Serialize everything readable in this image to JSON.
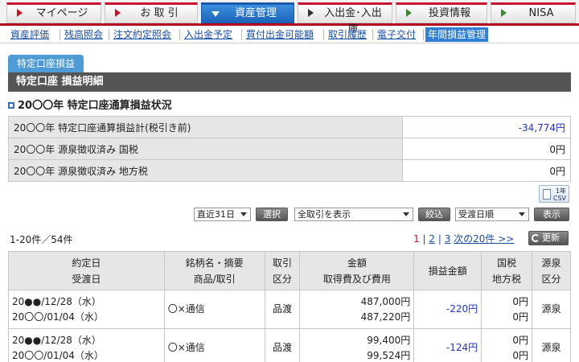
{
  "topnav": [
    {
      "label": "マイページ",
      "arrow": "red",
      "active": false
    },
    {
      "label": "お 取 引",
      "arrow": "red",
      "active": false
    },
    {
      "label": "資産管理",
      "arrow": "down",
      "active": true
    },
    {
      "label": "入出金･入出庫",
      "arrow": "dark",
      "active": false
    },
    {
      "label": "投資情報",
      "arrow": "green",
      "active": false
    },
    {
      "label": "NISA",
      "arrow": "green",
      "active": false
    }
  ],
  "subnav": [
    "資産評価",
    "残高照会",
    "注文約定照会",
    "入出金予定",
    "買付出金可能額",
    "取引履歴",
    "電子交付",
    "年間損益管理"
  ],
  "tab_label": "特定口座損益",
  "header_bar": "特定口座 損益明細",
  "section_title": "20〇〇年 特定口座通算損益状況",
  "summary": [
    {
      "label": "20〇〇年 特定口座通算損益計(税引き前)",
      "value": "-34,774円"
    },
    {
      "label": "20〇〇年 源泉徴収済み 国税",
      "value": "0円"
    },
    {
      "label": "20〇〇年 源泉徴収済み 地方税",
      "value": "0円"
    }
  ],
  "csv": {
    "year": "1年",
    "label": "CSV"
  },
  "filters": {
    "period": "直近31日",
    "select_button": "選択",
    "trade_filter": "全取引を表示",
    "narrow_button": "絞込",
    "sort": "受渡日順",
    "display_button": "表示"
  },
  "count_text": "1-20件／54件",
  "pager": {
    "current": "1",
    "pages": [
      "2",
      "3"
    ],
    "next": "次の20件 >>",
    "sep": "|"
  },
  "refresh_label": "更新",
  "table": {
    "headers": [
      [
        "約定日",
        "受渡日"
      ],
      [
        "銘柄名・摘要",
        "商品/取引"
      ],
      [
        "取引",
        "区分"
      ],
      [
        "金額",
        "取得費及び費用"
      ],
      [
        "損益金額"
      ],
      [
        "国税",
        "地方税"
      ],
      [
        "源泉",
        "区分"
      ]
    ],
    "rows": [
      {
        "trade_date": "20●●/12/28（水）",
        "settle_date": "20〇〇/01/04（水）",
        "name": "〇×通信",
        "type": "品渡",
        "amount": "487,000円",
        "cost": "487,220円",
        "pl": "-220円",
        "national_tax": "0円",
        "local_tax": "0円",
        "withholding": "源泉"
      },
      {
        "trade_date": "20●●/12/28（水）",
        "settle_date": "20〇〇/01/04（水）",
        "name": "〇×通信",
        "type": "品渡",
        "amount": "99,400円",
        "cost": "99,524円",
        "pl": "-124円",
        "national_tax": "0円",
        "local_tax": "0円",
        "withholding": "源泉"
      }
    ]
  },
  "colors": {
    "brand_red": "#c8102e",
    "active_blue": "#1c63b8",
    "negative_value": "#2233cc",
    "header_gray": "#555555"
  }
}
